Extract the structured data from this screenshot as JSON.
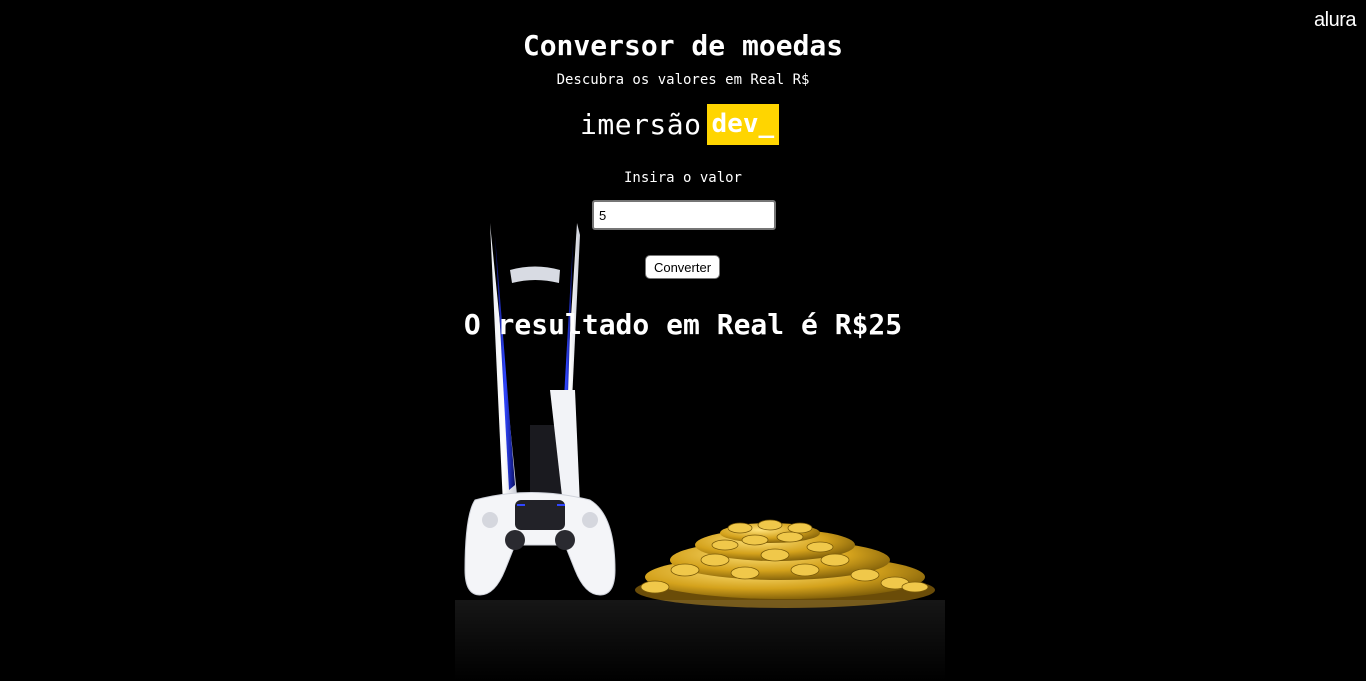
{
  "brand": {
    "logo_text": "alura"
  },
  "header": {
    "title": "Conversor de moedas",
    "subtitle": "Descubra os valores em Real R$"
  },
  "logo": {
    "left": "imersão",
    "right": "dev_"
  },
  "form": {
    "label": "Insira o valor",
    "input_value": "5",
    "button_label": "Converter"
  },
  "result": {
    "text": "O resultado em Real é R$25"
  },
  "colors": {
    "background": "#000000",
    "text": "#ffffff",
    "accent_yellow": "#ffd500",
    "console_glow": "#2a3bff",
    "coin_gold": "#d4a21c"
  },
  "icons": {
    "hero_console": "game-console-illustration",
    "hero_coins": "gold-coins-illustration"
  }
}
